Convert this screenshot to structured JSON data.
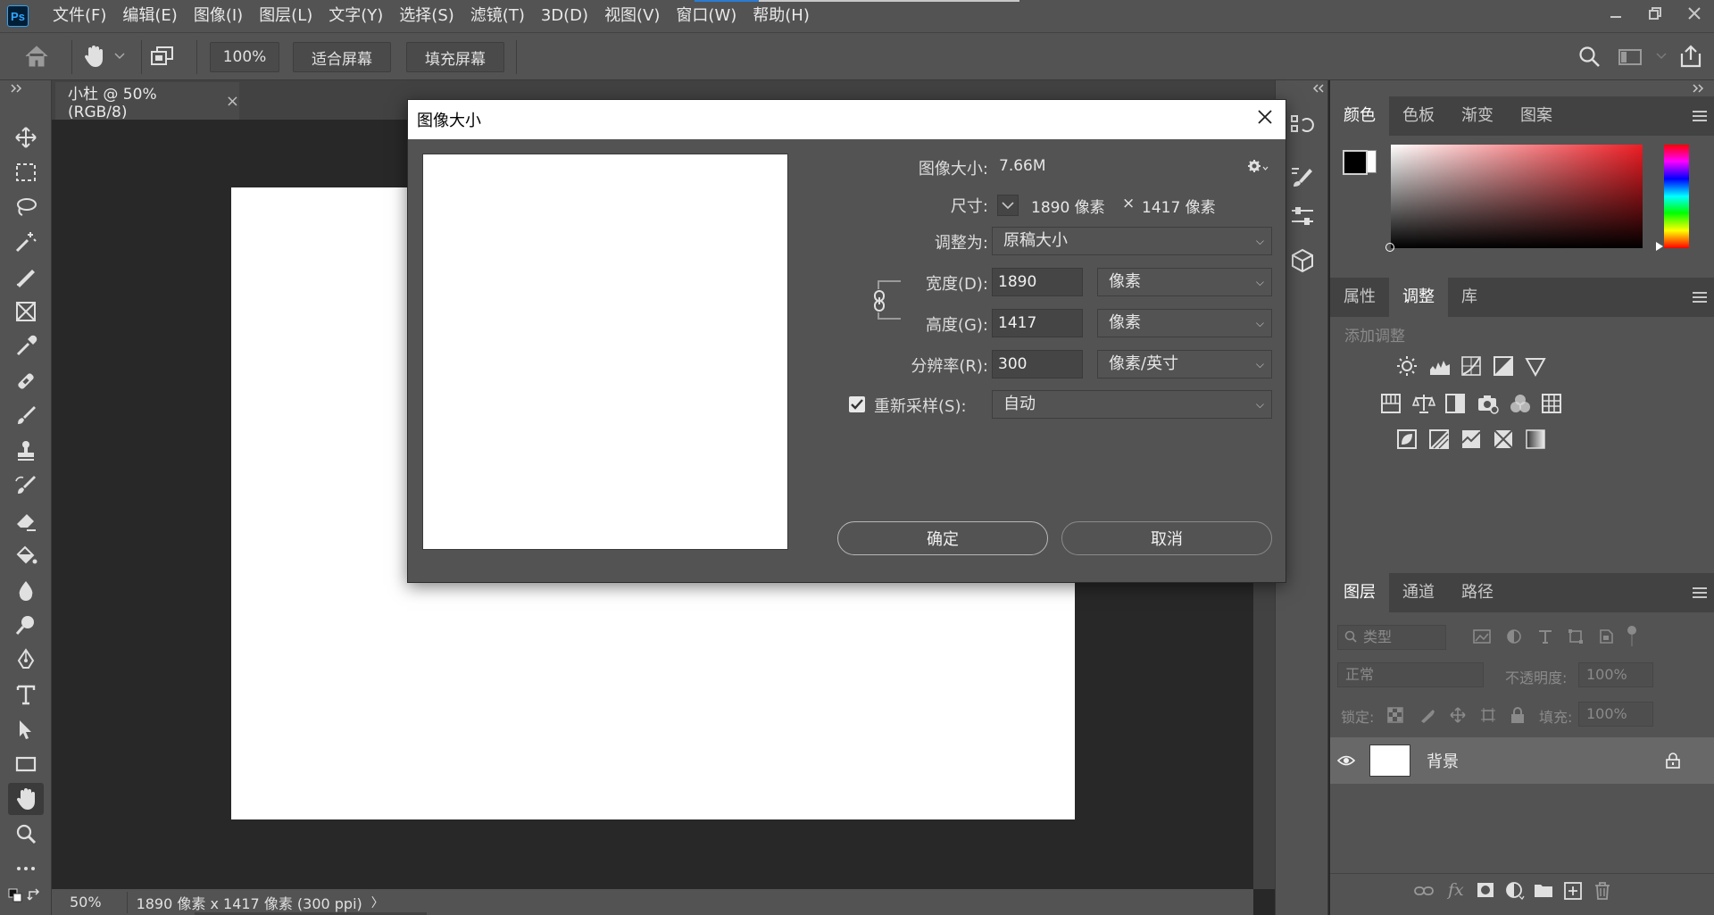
{
  "menubar": {
    "logo": "Ps",
    "items": [
      "文件(F)",
      "编辑(E)",
      "图像(I)",
      "图层(L)",
      "文字(Y)",
      "选择(S)",
      "滤镜(T)",
      "3D(D)",
      "视图(V)",
      "窗口(W)",
      "帮助(H)"
    ],
    "window_buttons": [
      "minimize-icon",
      "restore-icon",
      "close-icon"
    ]
  },
  "optionsbar": {
    "zoom": "100%",
    "fit_screen": "适合屏幕",
    "fill_screen": "填充屏幕"
  },
  "document": {
    "tab_title": "小杜 @ 50%(RGB/8)",
    "close": "×"
  },
  "statusbar": {
    "zoom": "50%",
    "info": "1890 像素 x 1417 像素 (300 ppi)",
    "arrow": "〉"
  },
  "dialog": {
    "title": "图像大小",
    "image_size_label": "图像大小:",
    "image_size_value": "7.66M",
    "dimensions_label": "尺寸:",
    "dimensions_width": "1890 像素",
    "dimensions_x": "×",
    "dimensions_height": "1417 像素",
    "fit_to_label": "调整为:",
    "fit_to_value": "原稿大小",
    "width_label": "宽度(D):",
    "width_value": "1890",
    "width_unit": "像素",
    "height_label": "高度(G):",
    "height_value": "1417",
    "height_unit": "像素",
    "resolution_label": "分辨率(R):",
    "resolution_value": "300",
    "resolution_unit": "像素/英寸",
    "resample_label": "重新采样(S):",
    "resample_checked": true,
    "resample_value": "自动",
    "ok": "确定",
    "cancel": "取消"
  },
  "color_panel": {
    "tabs": [
      "颜色",
      "色板",
      "渐变",
      "图案"
    ],
    "foreground": "#000000",
    "background": "#ffffff"
  },
  "adjust_panel": {
    "tabs": [
      "属性",
      "调整",
      "库"
    ],
    "add_label": "添加调整"
  },
  "layers_panel": {
    "tabs": [
      "图层",
      "通道",
      "路径"
    ],
    "filter_placeholder": "类型",
    "blend_mode": "正常",
    "opacity_label": "不透明度:",
    "opacity_value": "100%",
    "lock_label": "锁定:",
    "fill_label": "填充:",
    "fill_value": "100%",
    "layers": [
      {
        "name": "背景"
      }
    ]
  }
}
